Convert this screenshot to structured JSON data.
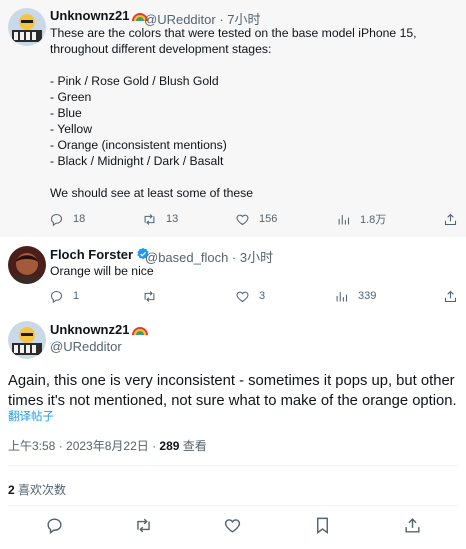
{
  "tweet1": {
    "author_name": "Unknownz21",
    "handle": "@URedditor",
    "time": "7小时",
    "body": "These are the colors that were tested on the base model iPhone 15,\nthroughout different development stages:\n\n- Pink / Rose Gold / Blush Gold\n- Green\n- Blue\n- Yellow\n- Orange (inconsistent mentions)\n- Black / Midnight / Dark / Basalt\n\nWe should see at least some of these",
    "replies": "18",
    "retweets": "13",
    "likes": "156",
    "views": "1.8万"
  },
  "tweet2": {
    "author_name": "Floch Forster",
    "handle": "@based_floch",
    "time": "3小时",
    "body": "Orange will be nice",
    "replies": "1",
    "retweets": "",
    "likes": "3",
    "views": "339"
  },
  "focus": {
    "author_name": "Unknownz21",
    "handle": "@URedditor",
    "body": "Again, this one is very inconsistent - sometimes it pops up, but other times it's not mentioned, not sure what to make of the orange option.",
    "translate_label": "翻译帖子",
    "timestamp": "上午3:58 · 2023年8月22日 · ",
    "view_count": "289",
    "view_label": " 查看",
    "like_count": "2",
    "like_label": " 喜欢次数"
  },
  "icons": [
    "reply-icon",
    "retweet-icon",
    "like-icon",
    "views-icon",
    "share-icon",
    "bookmark-icon",
    "verified-badge-icon",
    "rainbow-emoji"
  ],
  "colors": {
    "link": "#1d9bf0",
    "muted": "#536471",
    "text": "#0f1419",
    "hover_bg": "#f7f7f7"
  }
}
